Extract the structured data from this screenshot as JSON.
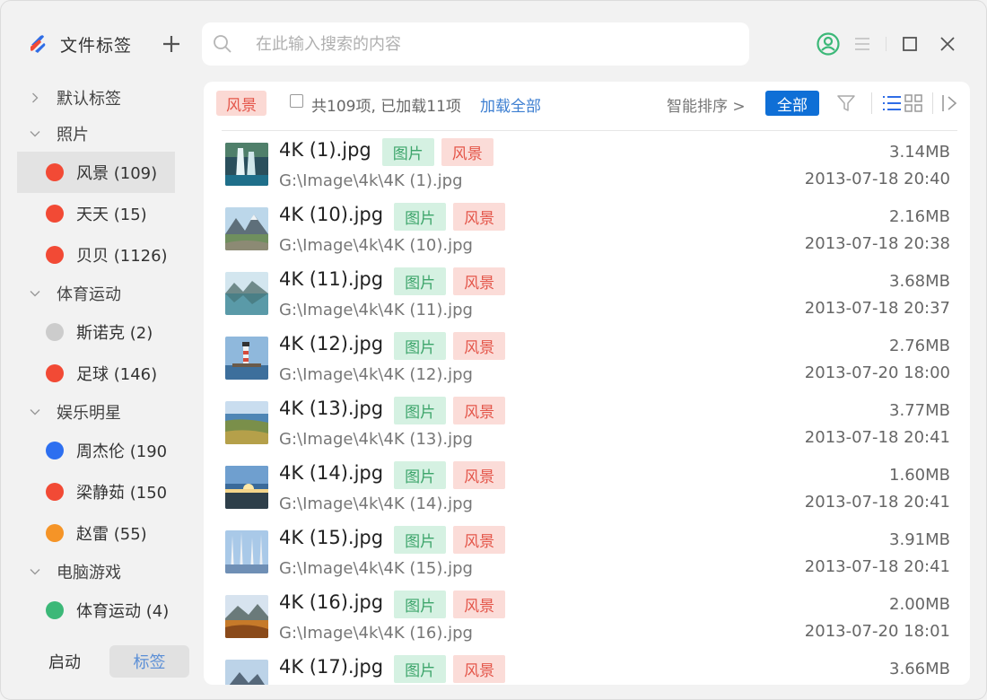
{
  "app": {
    "title": "文件标签"
  },
  "search": {
    "placeholder": "在此输入搜索的内容",
    "value": ""
  },
  "sidebar": {
    "groups": [
      {
        "label": "默认标签",
        "expanded": false,
        "items": []
      },
      {
        "label": "照片",
        "expanded": true,
        "items": [
          {
            "label": "风景 (109)",
            "color": "#f24a35",
            "active": true
          },
          {
            "label": "天天 (15)",
            "color": "#f24a35"
          },
          {
            "label": "贝贝 (1126)",
            "color": "#f24a35"
          }
        ]
      },
      {
        "label": "体育运动",
        "expanded": true,
        "items": [
          {
            "label": "斯诺克 (2)",
            "color": "#cccccc"
          },
          {
            "label": "足球 (146)",
            "color": "#f24a35"
          }
        ]
      },
      {
        "label": "娱乐明星",
        "expanded": true,
        "items": [
          {
            "label": "周杰伦 (190",
            "color": "#2d6ff0"
          },
          {
            "label": "梁静茹 (150",
            "color": "#f24a35"
          },
          {
            "label": "赵雷 (55)",
            "color": "#f59427"
          }
        ]
      },
      {
        "label": "电脑游戏",
        "expanded": true,
        "items": [
          {
            "label": "体育运动 (4)",
            "color": "#3cb878"
          }
        ]
      }
    ],
    "bottom_tabs": {
      "start": "启动",
      "tags": "标签"
    }
  },
  "toolbar": {
    "current_tag": "风景",
    "count_text": "共109项, 已加载11项",
    "load_all": "加载全部",
    "sort": "智能排序 >",
    "filter_all": "全部"
  },
  "files": [
    {
      "name": "4K (1).jpg",
      "tags": [
        "图片",
        "风景"
      ],
      "path": "G:\\Image\\4k\\4K (1).jpg",
      "size": "3.14MB",
      "date": "2013-07-18 20:40",
      "thumb": "waterfall"
    },
    {
      "name": "4K (10).jpg",
      "tags": [
        "图片",
        "风景"
      ],
      "path": "G:\\Image\\4k\\4K (10).jpg",
      "size": "2.16MB",
      "date": "2013-07-18 20:38",
      "thumb": "mountain"
    },
    {
      "name": "4K (11).jpg",
      "tags": [
        "图片",
        "风景"
      ],
      "path": "G:\\Image\\4k\\4K (11).jpg",
      "size": "3.68MB",
      "date": "2013-07-18 20:37",
      "thumb": "lake"
    },
    {
      "name": "4K (12).jpg",
      "tags": [
        "图片",
        "风景"
      ],
      "path": "G:\\Image\\4k\\4K (12).jpg",
      "size": "2.76MB",
      "date": "2013-07-20 18:00",
      "thumb": "lighthouse"
    },
    {
      "name": "4K (13).jpg",
      "tags": [
        "图片",
        "风景"
      ],
      "path": "G:\\Image\\4k\\4K (13).jpg",
      "size": "3.77MB",
      "date": "2013-07-18 20:41",
      "thumb": "coast"
    },
    {
      "name": "4K (14).jpg",
      "tags": [
        "图片",
        "风景"
      ],
      "path": "G:\\Image\\4k\\4K (14).jpg",
      "size": "1.60MB",
      "date": "2013-07-18 20:41",
      "thumb": "sunset"
    },
    {
      "name": "4K (15).jpg",
      "tags": [
        "图片",
        "风景"
      ],
      "path": "G:\\Image\\4k\\4K (15).jpg",
      "size": "3.91MB",
      "date": "2013-07-18 20:41",
      "thumb": "forest"
    },
    {
      "name": "4K (16).jpg",
      "tags": [
        "图片",
        "风景"
      ],
      "path": "G:\\Image\\4k\\4K (16).jpg",
      "size": "2.00MB",
      "date": "2013-07-20 18:01",
      "thumb": "autumn"
    },
    {
      "name": "4K (17).jpg",
      "tags": [
        "图片",
        "风景"
      ],
      "path": "",
      "size": "3.66MB",
      "date": "",
      "thumb": "peak"
    }
  ],
  "icons": {
    "logo": "app-logo-icon",
    "add": "plus-icon",
    "search": "search-icon",
    "user": "user-icon",
    "menu": "menu-icon",
    "maximize": "maximize-icon",
    "close": "close-icon",
    "filter": "filter-icon",
    "list_view": "list-view-icon",
    "grid_view": "grid-view-icon",
    "collapse_panel": "collapse-panel-icon"
  },
  "colors": {
    "accent": "#0f6fd6",
    "tag_red": "#e4564a",
    "tag_green": "#3da56b",
    "user_icon": "#3cb878"
  }
}
